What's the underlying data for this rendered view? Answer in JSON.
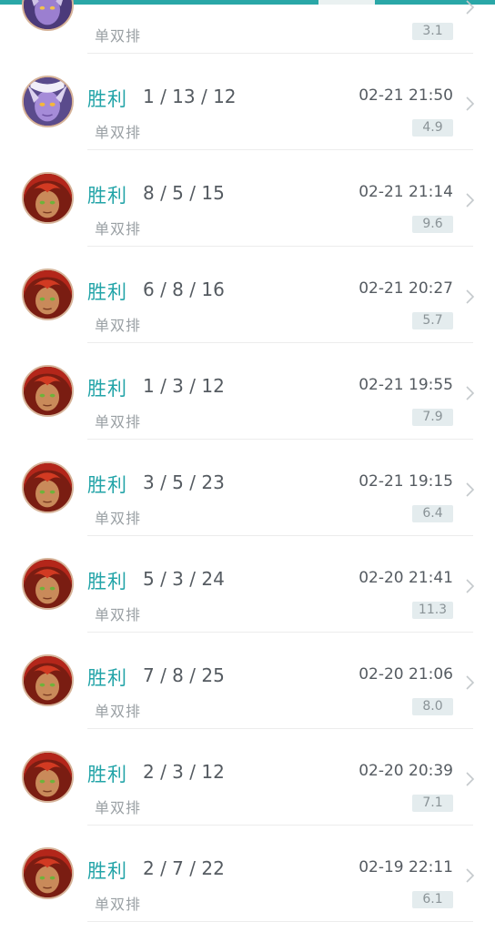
{
  "colors": {
    "accent": "#23a4a8",
    "text_dark": "#555b61",
    "text_muted": "#9aa0a4",
    "score_bg": "#e4ecee"
  },
  "matches": [
    {
      "result": "",
      "kda": "",
      "time": "",
      "mode": "单双排",
      "score": "3.1",
      "champion_icon": "purple-champion-icon"
    },
    {
      "result": "胜利",
      "kda": "1 / 13 / 12",
      "time": "02-21 21:50",
      "mode": "单双排",
      "score": "4.9",
      "champion_icon": "purple-champion-icon"
    },
    {
      "result": "胜利",
      "kda": "8 / 5 / 15",
      "time": "02-21 21:14",
      "mode": "单双排",
      "score": "9.6",
      "champion_icon": "red-hair-champion-icon"
    },
    {
      "result": "胜利",
      "kda": "6 / 8 / 16",
      "time": "02-21 20:27",
      "mode": "单双排",
      "score": "5.7",
      "champion_icon": "red-hair-champion-icon"
    },
    {
      "result": "胜利",
      "kda": "1 / 3 / 12",
      "time": "02-21 19:55",
      "mode": "单双排",
      "score": "7.9",
      "champion_icon": "red-hair-champion-icon"
    },
    {
      "result": "胜利",
      "kda": "3 / 5 / 23",
      "time": "02-21 19:15",
      "mode": "单双排",
      "score": "6.4",
      "champion_icon": "red-hair-champion-icon"
    },
    {
      "result": "胜利",
      "kda": "5 / 3 / 24",
      "time": "02-20 21:41",
      "mode": "单双排",
      "score": "11.3",
      "champion_icon": "red-hair-champion-icon"
    },
    {
      "result": "胜利",
      "kda": "7 / 8 / 25",
      "time": "02-20 21:06",
      "mode": "单双排",
      "score": "8.0",
      "champion_icon": "red-hair-champion-icon"
    },
    {
      "result": "胜利",
      "kda": "2 / 3 / 12",
      "time": "02-20 20:39",
      "mode": "单双排",
      "score": "7.1",
      "champion_icon": "red-hair-champion-icon"
    },
    {
      "result": "胜利",
      "kda": "2 / 7 / 22",
      "time": "02-19 22:11",
      "mode": "单双排",
      "score": "6.1",
      "champion_icon": "red-hair-champion-icon"
    }
  ]
}
